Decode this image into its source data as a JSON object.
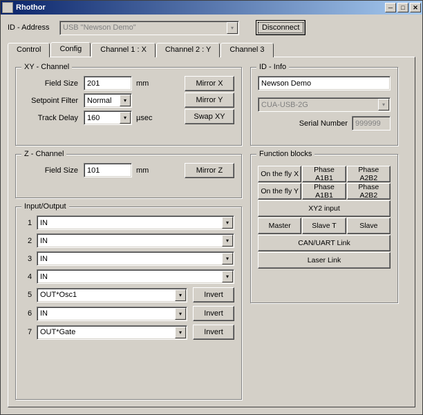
{
  "window": {
    "title": "Rhothor"
  },
  "toprow": {
    "label": "ID - Address",
    "address_value": "USB \"Newson Demo\"",
    "disconnect_label": "Disconnect"
  },
  "tabs": [
    "Control",
    "Config",
    "Channel 1 : X",
    "Channel 2 : Y",
    "Channel 3"
  ],
  "xy_channel": {
    "legend": "XY - Channel",
    "field_size_label": "Field Size",
    "field_size_value": "201",
    "mm": "mm",
    "setpoint_filter_label": "Setpoint Filter",
    "setpoint_filter_value": "Normal",
    "track_delay_label": "Track Delay",
    "track_delay_value": "160",
    "usec": "µsec",
    "mirror_x": "Mirror X",
    "mirror_y": "Mirror Y",
    "swap_xy": "Swap XY"
  },
  "z_channel": {
    "legend": "Z - Channel",
    "field_size_label": "Field Size",
    "field_size_value": "101",
    "mm": "mm",
    "mirror_z": "Mirror Z"
  },
  "io": {
    "legend": "Input/Output",
    "rows": [
      {
        "idx": "1",
        "value": "IN",
        "invert": ""
      },
      {
        "idx": "2",
        "value": "IN",
        "invert": ""
      },
      {
        "idx": "3",
        "value": "IN",
        "invert": ""
      },
      {
        "idx": "4",
        "value": "IN",
        "invert": ""
      },
      {
        "idx": "5",
        "value": "OUT*Osc1",
        "invert": "Invert"
      },
      {
        "idx": "6",
        "value": "IN",
        "invert": "Invert"
      },
      {
        "idx": "7",
        "value": "OUT*Gate",
        "invert": "Invert"
      }
    ]
  },
  "id_info": {
    "legend": "ID - Info",
    "name_value": "Newson Demo",
    "device_value": "CUA-USB-2G",
    "serial_label": "Serial Number",
    "serial_value": "999999"
  },
  "func": {
    "legend": "Function blocks",
    "on_fly_x": "On the fly X",
    "on_fly_y": "On the fly Y",
    "phase_a1b1_a": "Phase A1B1",
    "phase_a1b1_b": "Phase A1B1",
    "phase_a2b2_a": "Phase A2B2",
    "phase_a2b2_b": "Phase A2B2",
    "xy2_input": "XY2 input",
    "master": "Master",
    "slave_t": "Slave T",
    "slave": "Slave",
    "can_uart": "CAN/UART Link",
    "laser_link": "Laser Link"
  }
}
